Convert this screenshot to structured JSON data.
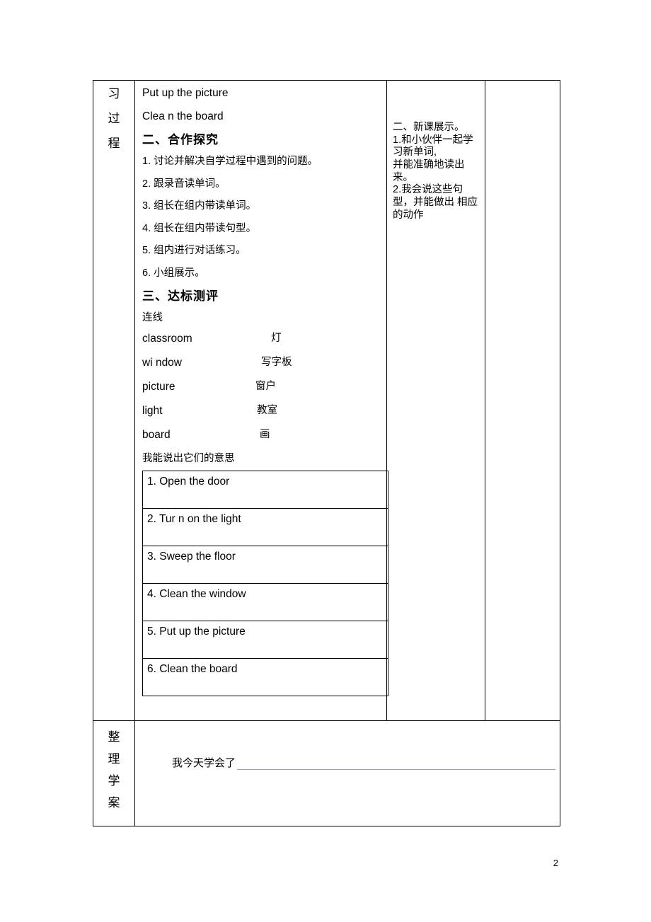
{
  "document": {
    "page_number": "2",
    "left_label_top": [
      "习",
      "过",
      "程"
    ],
    "left_label_bottom": [
      "整",
      "理",
      "学",
      "案"
    ],
    "main": {
      "intro_lines": [
        "Put up the picture",
        "Clea n the board"
      ],
      "heading_two": "二、合作探究",
      "items_two": [
        "1. 讨论并解决自学过程中遇到的问题。",
        "2. 跟录音读单词。",
        "3. 组长在组内带读单词。",
        "4. 组长在组内带读句型。",
        "5. 组内进行对话练习。",
        "6. 小组展示。"
      ],
      "heading_three": "三、达标测评",
      "match_title": "连线",
      "match_pairs": [
        {
          "en": "classroom",
          "cn": "灯"
        },
        {
          "en": "wi ndow",
          "cn": "写字板"
        },
        {
          "en": "picture",
          "cn": "窗户"
        },
        {
          "en": "light",
          "cn": "教室"
        },
        {
          "en": "board",
          "cn": "画"
        }
      ],
      "meaning_note": "我能说出它们的意思",
      "sentences": [
        "1. Open the door",
        "2. Tur n on the light",
        "3. Sweep the floor",
        "4. Clean the window",
        "5. Put up the picture",
        "6. Clean the board"
      ]
    },
    "right_column": "二、新课展示。\n1.和小伙伴一起学习新单词,\n并能准确地读出来。\n2.我会说这些句型，并能做出 相应的动作",
    "bottom": {
      "text": "我今天学会了"
    }
  }
}
